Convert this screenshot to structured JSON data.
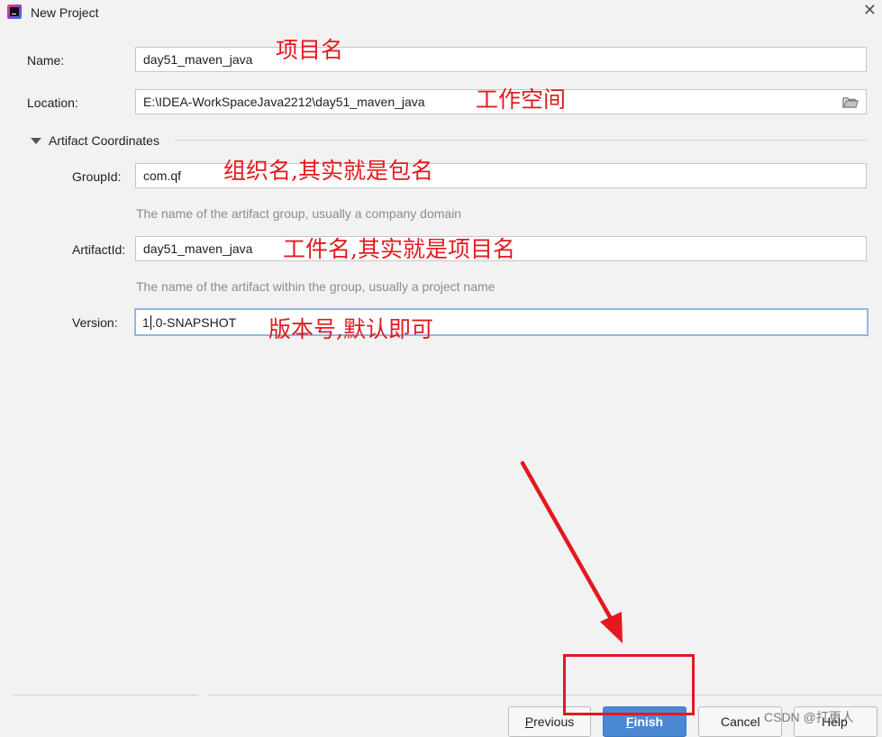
{
  "window": {
    "title": "New Project",
    "close_glyph": "✕"
  },
  "form": {
    "name_label": "Name:",
    "name_value": "day51_maven_java",
    "location_label": "Location:",
    "location_value": "E:\\IDEA-WorkSpaceJava2212\\day51_maven_java",
    "section_title": "Artifact Coordinates",
    "groupid_label": "GroupId:",
    "groupid_value": "com.qf",
    "groupid_hint": "The name of the artifact group, usually a company domain",
    "artifactid_label": "ArtifactId:",
    "artifactid_value": "day51_maven_java",
    "artifactid_hint": "The name of the artifact within the group, usually a project name",
    "version_label": "Version:",
    "version_value_before_caret": "1",
    "version_value_after_caret": ".0-SNAPSHOT"
  },
  "annotations": {
    "name": "项目名",
    "location": "工作空间",
    "groupid": "组织名,其实就是包名",
    "artifactid": "工件名,其实就是项目名",
    "version": "版本号,默认即可"
  },
  "buttons": {
    "previous_mnemonic": "P",
    "previous_rest": "revious",
    "finish_mnemonic": "F",
    "finish_rest": "inish",
    "cancel": "Cancel",
    "help": "Help"
  },
  "watermark": "CSDN @打更人",
  "colors": {
    "annotation_red": "#e3191f",
    "primary_button": "#4a88d4",
    "focus_border": "#8db7e8"
  },
  "icons": {
    "app": "intellij-idea-icon",
    "close": "close-icon",
    "folder": "folder-icon",
    "section_toggle": "triangle-down-icon"
  }
}
